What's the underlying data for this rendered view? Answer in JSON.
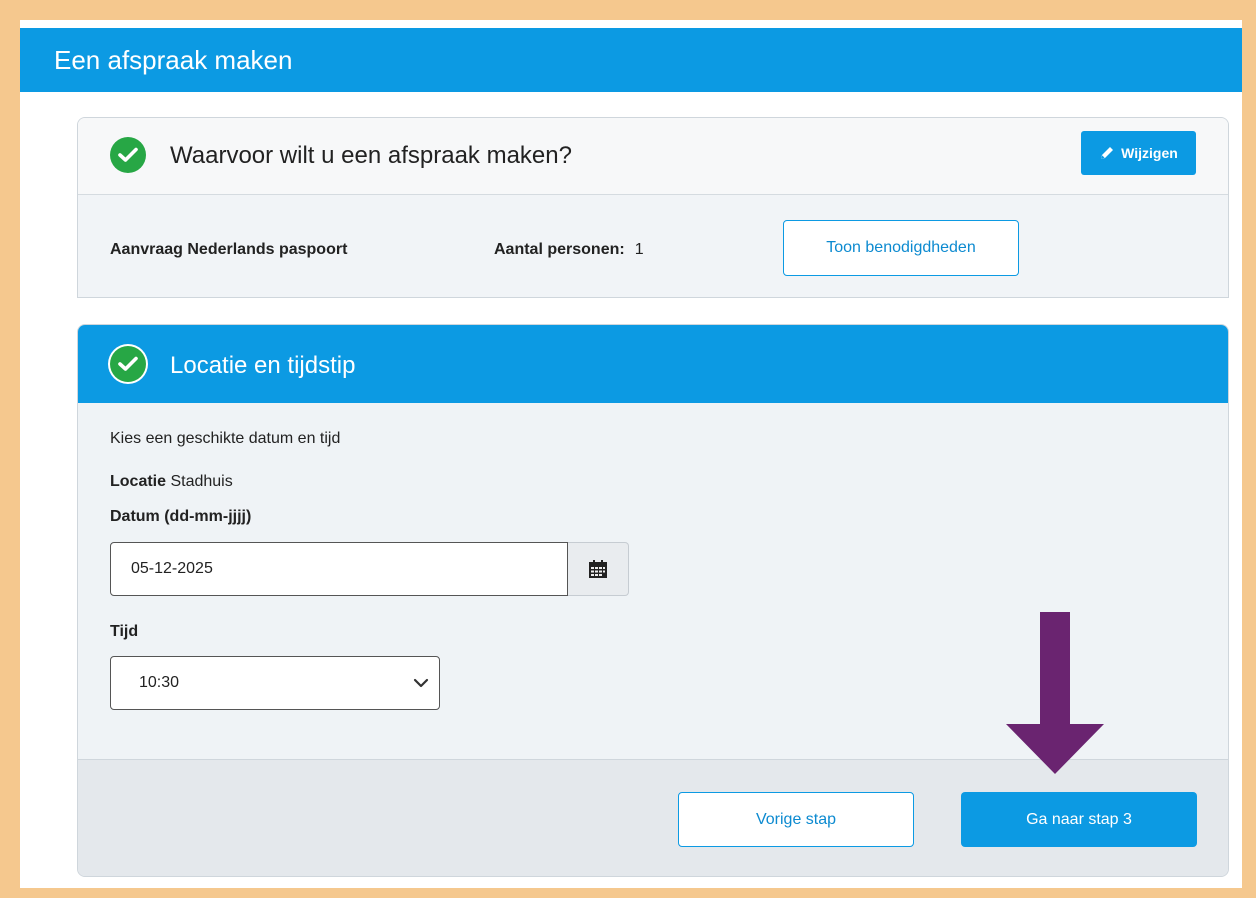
{
  "header": {
    "title": "Een afspraak maken"
  },
  "step1": {
    "title": "Waarvoor wilt u een afspraak maken?",
    "edit_label": "Wijzigen",
    "service": "Aanvraag Nederlands paspoort",
    "persons_label": "Aantal personen:",
    "persons_value": "1",
    "requirements_label": "Toon benodigdheden"
  },
  "step2": {
    "title": "Locatie en tijdstip",
    "intro": "Kies een geschikte datum en tijd",
    "location_label": "Locatie",
    "location_value": "Stadhuis",
    "date_label": "Datum (dd-mm-jjjj)",
    "date_value": "05-12-2025",
    "time_label": "Tijd",
    "time_value": "10:30",
    "prev_label": "Vorige stap",
    "next_label": "Ga naar stap 3"
  },
  "colors": {
    "brand": "#0c9ae3",
    "success": "#27a745",
    "annotation_arrow": "#6a2470",
    "border_frame": "#f5c88e"
  },
  "icons": [
    "check-icon",
    "pencil-icon",
    "calendar-icon",
    "chevron-down-icon",
    "down-arrow-annotation"
  ]
}
